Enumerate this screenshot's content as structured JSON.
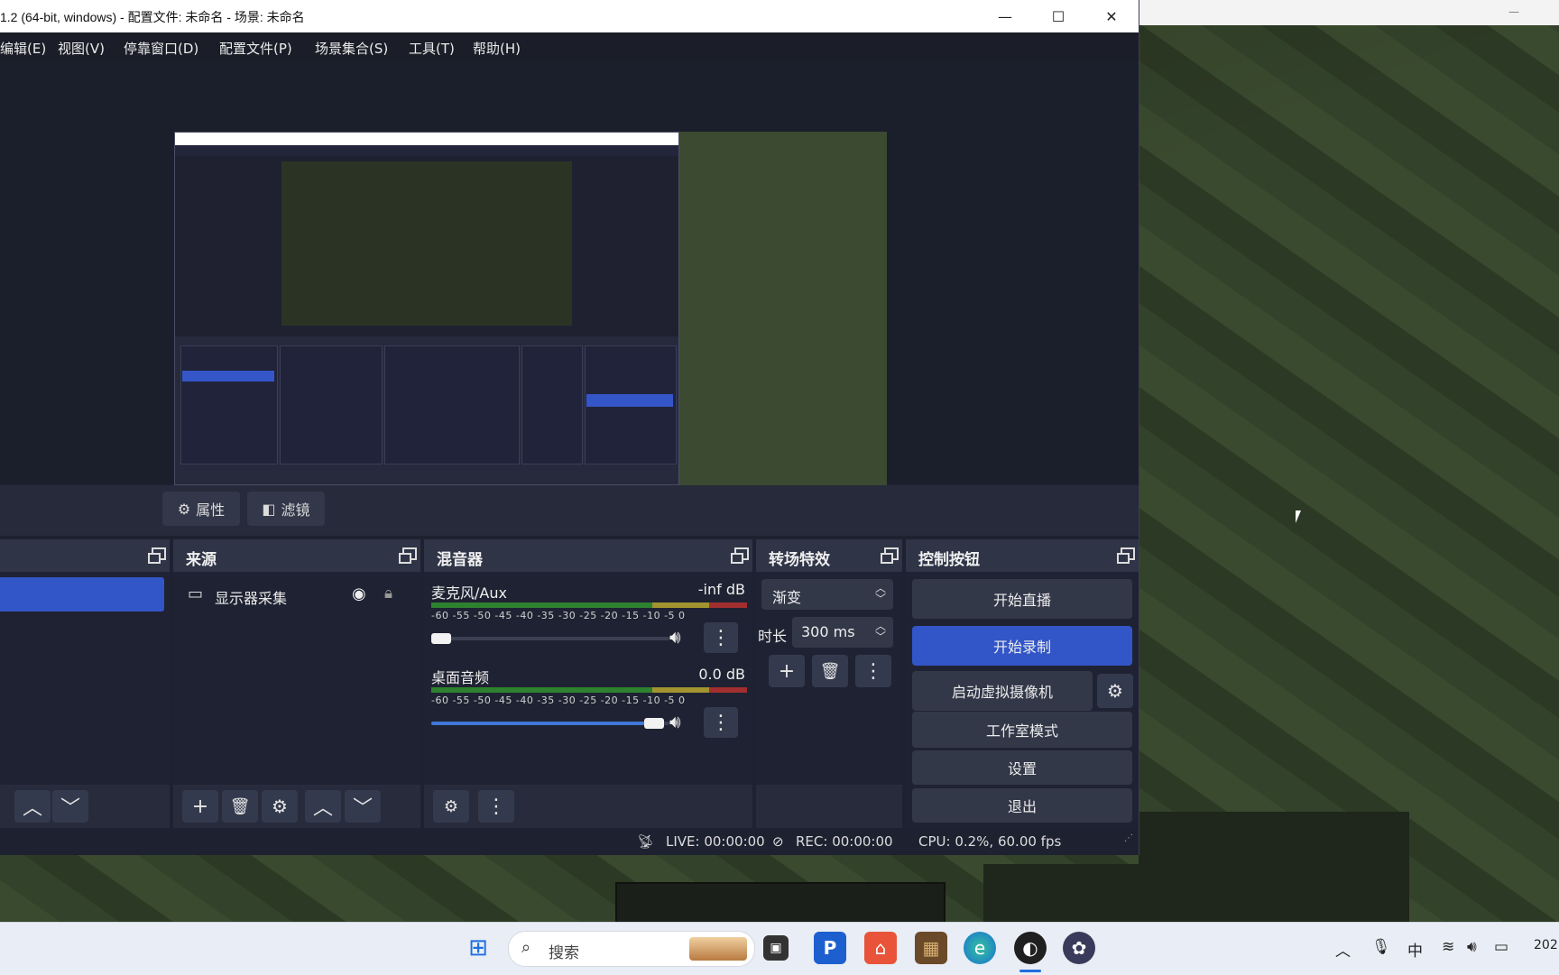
{
  "window": {
    "title": "1.2 (64-bit, windows) - 配置文件: 未命名 - 场景: 未命名",
    "minimize_icon": "minimize-icon",
    "maximize_icon": "maximize-icon",
    "close_icon": "close-icon"
  },
  "menu": [
    "编辑(E)",
    "视图(V)",
    "停靠窗口(D)",
    "配置文件(P)",
    "场景集合(S)",
    "工具(T)",
    "帮助(H)"
  ],
  "preview_toolbar": {
    "properties_label": "属性",
    "filters_label": "滤镜"
  },
  "sources": {
    "title": "来源",
    "items": [
      {
        "label": "显示器采集",
        "icon": "monitor-icon",
        "visible": true,
        "locked": true
      }
    ]
  },
  "mixer": {
    "title": "混音器",
    "scale": "-60 -55 -50 -45 -40 -35 -30 -25 -20 -15 -10 -5 0",
    "channels": [
      {
        "name": "麦克风/Aux",
        "level": "-inf dB",
        "volume": 0.0
      },
      {
        "name": "桌面音频",
        "level": "0.0 dB",
        "volume": 1.0
      }
    ]
  },
  "transitions": {
    "title": "转场特效",
    "selected": "渐变",
    "duration_label": "时长",
    "duration_value": "300 ms"
  },
  "controls": {
    "title": "控制按钮",
    "start_streaming": "开始直播",
    "start_recording": "开始录制",
    "start_virtual_camera": "启动虚拟摄像机",
    "studio_mode": "工作室模式",
    "settings": "设置",
    "exit": "退出"
  },
  "status": {
    "live": "LIVE: 00:00:00",
    "rec": "REC: 00:00:00",
    "cpu": "CPU: 0.2%, 60.00 fps"
  },
  "taskbar": {
    "search_placeholder": "搜索",
    "ime": "中",
    "clock_partial": "202"
  },
  "colors": {
    "accent": "#3256c8",
    "panel": "#272b3b",
    "background": "#1e2130"
  }
}
